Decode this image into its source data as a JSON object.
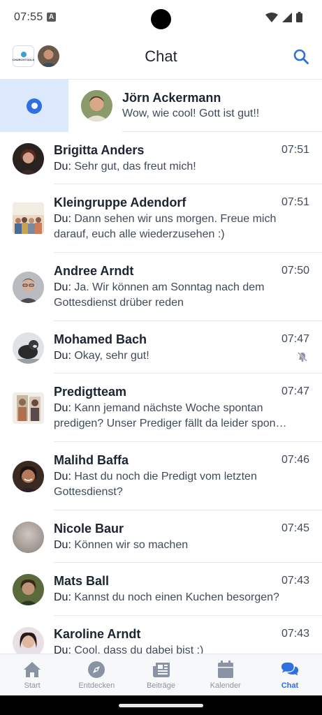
{
  "status_bar": {
    "time": "07:55",
    "notification_glyph": "A"
  },
  "header": {
    "title": "Chat",
    "org_logo_text": "CHURCHTOOLS"
  },
  "pinned": {
    "name": "Jörn Ackermann",
    "message": "Wow, wie cool! Gott ist gut!!"
  },
  "chats": [
    {
      "name": "Brigitta Anders",
      "time": "07:51",
      "prefix": "Du:",
      "lines": [
        "Sehr gut, das freut mich!"
      ]
    },
    {
      "name": "Kleingruppe Adendorf",
      "time": "07:51",
      "prefix": "Du:",
      "lines": [
        "Dann sehen wir uns morgen. Freue mich",
        "darauf, euch alle wiederzusehen :)"
      ]
    },
    {
      "name": "Andree Arndt",
      "time": "07:50",
      "prefix": "Du:",
      "lines": [
        "Ja. Wir können am Sonntag nach dem",
        "Gottesdienst drüber reden"
      ]
    },
    {
      "name": "Mohamed Bach",
      "time": "07:47",
      "prefix": "Du:",
      "lines": [
        "Okay, sehr gut!"
      ]
    },
    {
      "name": "Predigtteam",
      "time": "07:47",
      "prefix": "Du:",
      "lines": [
        "Kann jemand nächste Woche spontan",
        "predigen? Unser Prediger fällt da leider spon…"
      ]
    },
    {
      "name": "Malihd Baffa",
      "time": "07:46",
      "prefix": "Du:",
      "lines": [
        "Hast du noch die Predigt vom letzten",
        "Gottesdienst?"
      ]
    },
    {
      "name": "Nicole Baur",
      "time": "07:45",
      "prefix": "Du:",
      "lines": [
        "Können wir so machen"
      ]
    },
    {
      "name": "Mats Ball",
      "time": "07:43",
      "prefix": "Du:",
      "lines": [
        "Kannst du noch einen Kuchen besorgen?"
      ]
    },
    {
      "name": "Karoline Arndt",
      "time": "07:43",
      "prefix": "Du:",
      "lines": [
        "Cool, dass du dabei bist :)"
      ]
    }
  ],
  "nav": [
    {
      "label": "Start",
      "icon": "home-icon"
    },
    {
      "label": "Entdecken",
      "icon": "compass-icon"
    },
    {
      "label": "Beiträge",
      "icon": "newspaper-icon"
    },
    {
      "label": "Kalender",
      "icon": "calendar-icon"
    },
    {
      "label": "Chat",
      "icon": "chat-bubbles-icon"
    }
  ],
  "colors": {
    "accent": "#2f6fe0",
    "selection_bg": "#dce8fb",
    "nav_inactive": "#8a93a3"
  }
}
